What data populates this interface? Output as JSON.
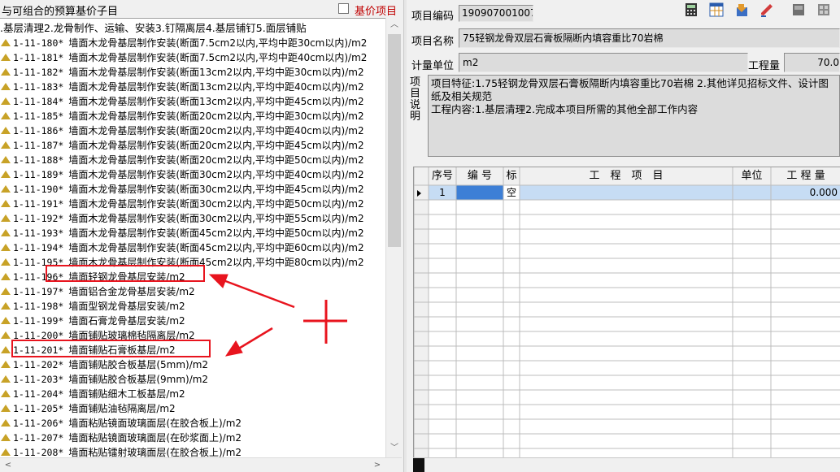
{
  "left": {
    "title": "与可组合的预算基价子目",
    "base_price_label": "基价项目",
    "tree_header": ".基层清理2.龙骨制作、运输、安装3.钉隔离层4.基层铺钉5.面层铺贴",
    "items": [
      {
        "code": "1-11-180*",
        "name": "墙面木龙骨基层制作安装(断面7.5cm2以内,平均中距30cm以内)/m2"
      },
      {
        "code": "1-11-181*",
        "name": "墙面木龙骨基层制作安装(断面7.5cm2以内,平均中距40cm以内)/m2"
      },
      {
        "code": "1-11-182*",
        "name": "墙面木龙骨基层制作安装(断面13cm2以内,平均中距30cm以内)/m2"
      },
      {
        "code": "1-11-183*",
        "name": "墙面木龙骨基层制作安装(断面13cm2以内,平均中距40cm以内)/m2"
      },
      {
        "code": "1-11-184*",
        "name": "墙面木龙骨基层制作安装(断面13cm2以内,平均中距45cm以内)/m2"
      },
      {
        "code": "1-11-185*",
        "name": "墙面木龙骨基层制作安装(断面20cm2以内,平均中距30cm以内)/m2"
      },
      {
        "code": "1-11-186*",
        "name": "墙面木龙骨基层制作安装(断面20cm2以内,平均中距40cm以内)/m2"
      },
      {
        "code": "1-11-187*",
        "name": "墙面木龙骨基层制作安装(断面20cm2以内,平均中距45cm以内)/m2"
      },
      {
        "code": "1-11-188*",
        "name": "墙面木龙骨基层制作安装(断面20cm2以内,平均中距50cm以内)/m2"
      },
      {
        "code": "1-11-189*",
        "name": "墙面木龙骨基层制作安装(断面30cm2以内,平均中距40cm以内)/m2"
      },
      {
        "code": "1-11-190*",
        "name": "墙面木龙骨基层制作安装(断面30cm2以内,平均中距45cm以内)/m2"
      },
      {
        "code": "1-11-191*",
        "name": "墙面木龙骨基层制作安装(断面30cm2以内,平均中距50cm以内)/m2"
      },
      {
        "code": "1-11-192*",
        "name": "墙面木龙骨基层制作安装(断面30cm2以内,平均中距55cm以内)/m2"
      },
      {
        "code": "1-11-193*",
        "name": "墙面木龙骨基层制作安装(断面45cm2以内,平均中距50cm以内)/m2"
      },
      {
        "code": "1-11-194*",
        "name": "墙面木龙骨基层制作安装(断面45cm2以内,平均中距60cm以内)/m2"
      },
      {
        "code": "1-11-195*",
        "name": "墙面木龙骨基层制作安装(断面45cm2以内,平均中距80cm以内)/m2"
      },
      {
        "code": "1-11-196*",
        "name": "墙面轻钢龙骨基层安装/m2"
      },
      {
        "code": "1-11-197*",
        "name": "墙面铝合金龙骨基层安装/m2"
      },
      {
        "code": "1-11-198*",
        "name": "墙面型钢龙骨基层安装/m2"
      },
      {
        "code": "1-11-199*",
        "name": "墙面石膏龙骨基层安装/m2"
      },
      {
        "code": "1-11-200*",
        "name": "墙面铺贴玻璃棉毡隔离层/m2"
      },
      {
        "code": "1-11-201*",
        "name": "墙面铺贴石膏板基层/m2"
      },
      {
        "code": "1-11-202*",
        "name": "墙面铺贴胶合板基层(5mm)/m2"
      },
      {
        "code": "1-11-203*",
        "name": "墙面铺贴胶合板基层(9mm)/m2"
      },
      {
        "code": "1-11-204*",
        "name": "墙面铺贴细木工板基层/m2"
      },
      {
        "code": "1-11-205*",
        "name": "墙面铺贴油毡隔离层/m2"
      },
      {
        "code": "1-11-206*",
        "name": "墙面粘贴镜面玻璃面层(在胶合板上)/m2"
      },
      {
        "code": "1-11-207*",
        "name": "墙面粘贴镜面玻璃面层(在砂浆面上)/m2"
      },
      {
        "code": "1-11-208*",
        "name": "墙面粘贴镭射玻璃面层(在胶合板上)/m2"
      }
    ]
  },
  "right": {
    "code_label": "项目编码",
    "code_value": "190907001007",
    "name_label": "项目名称",
    "name_value": "75轻钢龙骨双层石膏板隔断内填容重比70岩棉",
    "unit_label": "计量单位",
    "unit_value": "m2",
    "qty_label": "工程量",
    "qty_value": "70.0",
    "desc_label": "项目说明",
    "desc_text": "项目特征:1.75轻钢龙骨双层石膏板隔断内填容重比70岩棉 2.其他详见招标文件、设计图纸及相关规范\n工程内容:1.基层清理2.完成本项目所需的其他全部工作内容",
    "toolbar_icons": [
      "calculator-icon",
      "table-icon",
      "export-icon",
      "edit-icon",
      "flag-icon",
      "options-icon",
      "dropdown-icon"
    ],
    "grid": {
      "headers": [
        "序号",
        "编 号",
        "标",
        "工　程　项　目",
        "单位",
        "工 程 量"
      ],
      "rows": [
        {
          "seq": "1",
          "code": "",
          "mark": "空",
          "item": "",
          "unit": "",
          "qty": "0.000"
        }
      ]
    }
  },
  "annotations": {
    "plus_mark": "+"
  }
}
